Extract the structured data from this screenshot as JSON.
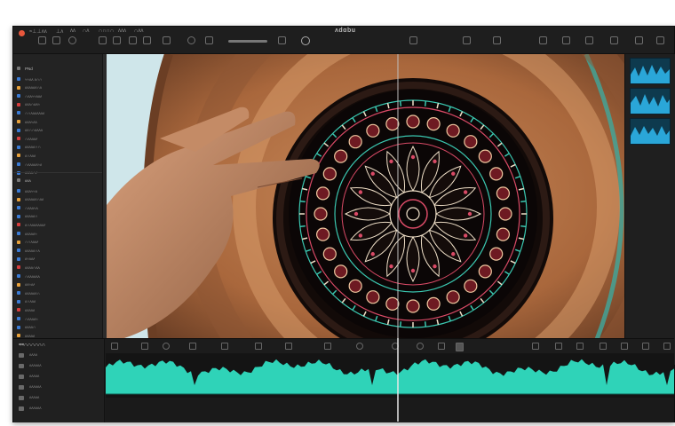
{
  "window": {
    "title": "ʌdɑbu",
    "menus": [
      "≈⊥⊥ʌʌ",
      "⊥ʌ",
      "ʌʌ",
      "∩ʌ",
      "∩∩∩∩",
      "ʌʌʌ",
      "∩ʌʌ"
    ]
  },
  "sidebar": {
    "groups": [
      {
        "header": "PNd",
        "items": [
          {
            "label": "≈≈ʌʌ ʌ∩∩",
            "color": "#3a7bd5"
          },
          {
            "label": "ʌʌʌʌʌʌ∩ʌ",
            "color": "#e8a13a"
          },
          {
            "label": "∩ʌʌ≈≈ʌʌʌ",
            "color": "#3a7bd5"
          },
          {
            "label": "ʌʌʌ∩ʌʌ≈",
            "color": "#d63e3e"
          },
          {
            "label": "∩∩ʌʌʌʌʌʌʌ",
            "color": "#3a7bd5"
          },
          {
            "label": "ʌʌʌ≈ʌʌ",
            "color": "#e8a13a"
          },
          {
            "label": "ʌʌ∩∩ʌʌʌʌ",
            "color": "#3a7bd5"
          },
          {
            "label": "∩ʌʌʌʌʌ",
            "color": "#d63e3e"
          },
          {
            "label": "ʌʌʌʌʌ∩∩",
            "color": "#3a7bd5"
          },
          {
            "label": "ʌ∩ʌʌʌ",
            "color": "#e8a13a"
          },
          {
            "label": "∩ʌʌʌʌʌ≈ʌ",
            "color": "#3a7bd5"
          },
          {
            "label": "ʌʌʌʌ∩ʌ",
            "color": "#3a7bd5"
          }
        ]
      },
      {
        "header": "ʌʌʌ",
        "items": [
          {
            "label": "ʌʌʌ≈≈ʌ",
            "color": "#3a7bd5"
          },
          {
            "label": "ʌʌʌʌʌʌ∩ʌʌ",
            "color": "#e8a13a"
          },
          {
            "label": "∩ʌʌʌ≈ʌ",
            "color": "#3a7bd5"
          },
          {
            "label": "ʌʌʌʌʌ∩",
            "color": "#3a7bd5"
          },
          {
            "label": "ʌ∩ʌʌʌʌʌʌʌʌ",
            "color": "#d63e3e"
          },
          {
            "label": "ʌʌʌʌʌ≈",
            "color": "#3a7bd5"
          },
          {
            "label": "∩∩ʌʌʌʌ",
            "color": "#e8a13a"
          },
          {
            "label": "ʌʌʌʌʌ∩ʌ",
            "color": "#3a7bd5"
          },
          {
            "label": "ʌ≈ʌʌʌ",
            "color": "#3a7bd5"
          },
          {
            "label": "ʌʌʌʌ∩ʌʌ",
            "color": "#d63e3e"
          },
          {
            "label": "∩ʌʌʌʌʌʌ",
            "color": "#3a7bd5"
          },
          {
            "label": "ʌʌ≈ʌʌ",
            "color": "#e8a13a"
          },
          {
            "label": "ʌʌʌʌʌʌ∩",
            "color": "#3a7bd5"
          },
          {
            "label": "ʌ∩ʌʌʌ",
            "color": "#3a7bd5"
          },
          {
            "label": "ʌʌʌʌʌ",
            "color": "#d63e3e"
          },
          {
            "label": "∩ʌʌʌʌ≈",
            "color": "#3a7bd5"
          },
          {
            "label": "ʌʌʌʌ∩",
            "color": "#3a7bd5"
          },
          {
            "label": "ʌʌʌʌʌ",
            "color": "#e8a13a"
          },
          {
            "label": "ʌʌ∩ʌ",
            "color": "#3a7bd5"
          }
        ]
      }
    ]
  },
  "timeline": {
    "header": "≈≈∩∩∩∩∩∩",
    "tracks": [
      {
        "label": "ʌʌʌʌ"
      },
      {
        "label": "ʌʌʌʌʌʌ"
      },
      {
        "label": "ʌʌʌʌʌ"
      },
      {
        "label": "ʌʌʌʌʌʌ"
      },
      {
        "label": "ʌʌʌʌʌ"
      },
      {
        "label": "ʌʌʌʌʌʌ"
      }
    ]
  },
  "colors": {
    "waveform": "#2fd3b8",
    "accent": "#e8573c",
    "panel": "#262626",
    "thumbnail_wave": "#2aa6d8"
  },
  "icons": [
    "close-dot-icon",
    "play-icon",
    "scissors-icon",
    "magnet-icon",
    "zoom-icon",
    "gear-icon"
  ]
}
